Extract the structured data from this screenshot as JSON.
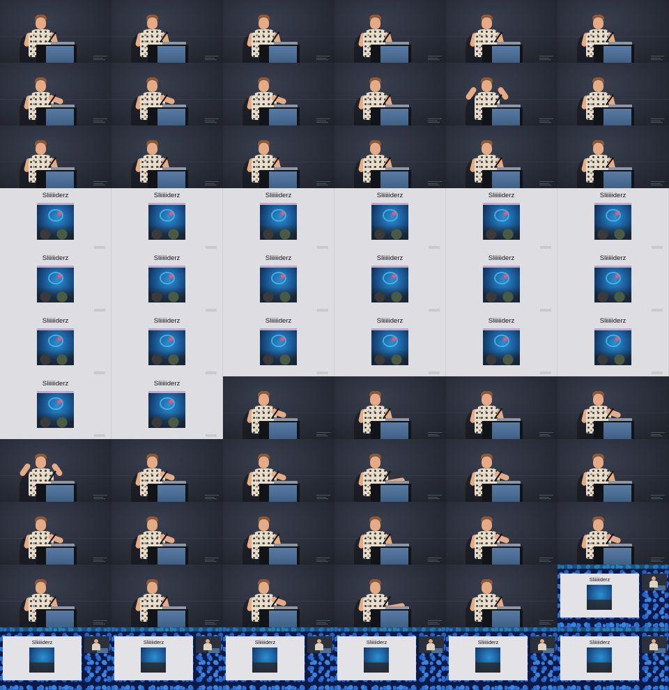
{
  "slide_title": "Sliiiiiderz",
  "frames": [
    {
      "kind": "speaker",
      "pose": "idle"
    },
    {
      "kind": "speaker",
      "pose": "idle"
    },
    {
      "kind": "speaker",
      "pose": "idle"
    },
    {
      "kind": "speaker",
      "pose": "idle"
    },
    {
      "kind": "speaker",
      "pose": "idle"
    },
    {
      "kind": "speaker",
      "pose": "idle"
    },
    {
      "kind": "speaker",
      "pose": "gesture"
    },
    {
      "kind": "speaker",
      "pose": "gesture"
    },
    {
      "kind": "speaker",
      "pose": "gesture"
    },
    {
      "kind": "speaker",
      "pose": "idle"
    },
    {
      "kind": "speaker",
      "pose": "raise"
    },
    {
      "kind": "speaker",
      "pose": "idle"
    },
    {
      "kind": "speaker",
      "pose": "idle"
    },
    {
      "kind": "speaker",
      "pose": "idle"
    },
    {
      "kind": "speaker",
      "pose": "idle"
    },
    {
      "kind": "speaker",
      "pose": "idle"
    },
    {
      "kind": "speaker",
      "pose": "idle"
    },
    {
      "kind": "speaker",
      "pose": "idle"
    },
    {
      "kind": "slide"
    },
    {
      "kind": "slide"
    },
    {
      "kind": "slide"
    },
    {
      "kind": "slide"
    },
    {
      "kind": "slide"
    },
    {
      "kind": "slide"
    },
    {
      "kind": "slide"
    },
    {
      "kind": "slide"
    },
    {
      "kind": "slide"
    },
    {
      "kind": "slide"
    },
    {
      "kind": "slide"
    },
    {
      "kind": "slide"
    },
    {
      "kind": "slide"
    },
    {
      "kind": "slide"
    },
    {
      "kind": "slide"
    },
    {
      "kind": "slide"
    },
    {
      "kind": "slide"
    },
    {
      "kind": "slide"
    },
    {
      "kind": "slide"
    },
    {
      "kind": "slide"
    },
    {
      "kind": "speaker",
      "pose": "gesture"
    },
    {
      "kind": "speaker",
      "pose": "idle"
    },
    {
      "kind": "speaker",
      "pose": "idle"
    },
    {
      "kind": "speaker",
      "pose": "gesture"
    },
    {
      "kind": "speaker",
      "pose": "raise"
    },
    {
      "kind": "speaker",
      "pose": "gesture"
    },
    {
      "kind": "speaker",
      "pose": "gesture"
    },
    {
      "kind": "speaker",
      "pose": "point"
    },
    {
      "kind": "speaker",
      "pose": "gesture"
    },
    {
      "kind": "speaker",
      "pose": "idle"
    },
    {
      "kind": "speaker",
      "pose": "gesture"
    },
    {
      "kind": "speaker",
      "pose": "gesture"
    },
    {
      "kind": "speaker",
      "pose": "idle"
    },
    {
      "kind": "speaker",
      "pose": "idle"
    },
    {
      "kind": "speaker",
      "pose": "gesture"
    },
    {
      "kind": "speaker",
      "pose": "gesture"
    },
    {
      "kind": "speaker",
      "pose": "idle"
    },
    {
      "kind": "speaker",
      "pose": "idle"
    },
    {
      "kind": "speaker",
      "pose": "gesture"
    },
    {
      "kind": "speaker",
      "pose": "point"
    },
    {
      "kind": "speaker",
      "pose": "idle"
    },
    {
      "kind": "composite"
    },
    {
      "kind": "composite"
    },
    {
      "kind": "composite"
    },
    {
      "kind": "composite"
    },
    {
      "kind": "composite"
    },
    {
      "kind": "composite"
    },
    {
      "kind": "composite"
    }
  ]
}
